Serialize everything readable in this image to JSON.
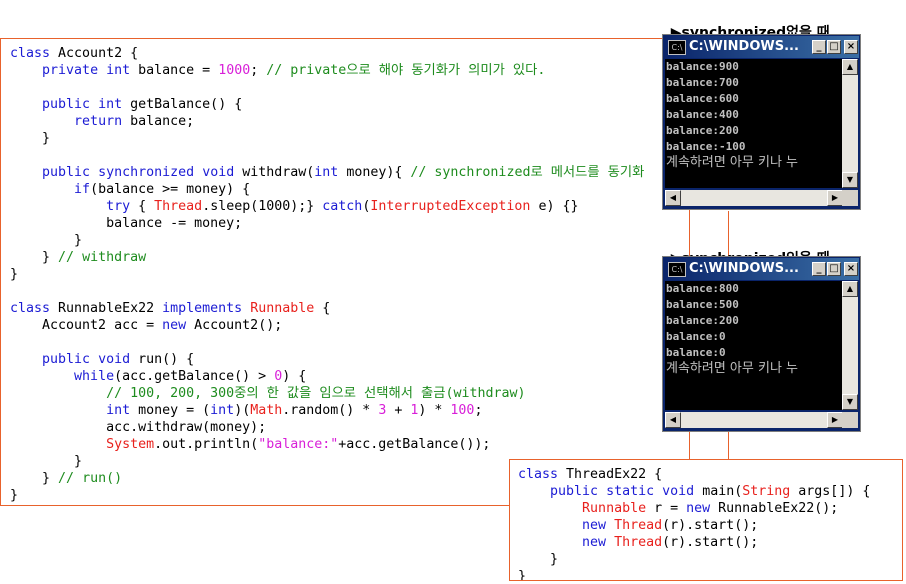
{
  "main_code": {
    "lines": [
      [
        [
          "kw",
          "class"
        ],
        [
          "txt",
          " Account2 {"
        ]
      ],
      [
        [
          "txt",
          "    "
        ],
        [
          "kw",
          "private"
        ],
        [
          "txt",
          " "
        ],
        [
          "kw",
          "int"
        ],
        [
          "txt",
          " balance = "
        ],
        [
          "num",
          "1000"
        ],
        [
          "txt",
          "; "
        ],
        [
          "cm",
          "// private으로 해야 동기화가 의미가 있다."
        ]
      ],
      [
        [
          "txt",
          ""
        ]
      ],
      [
        [
          "txt",
          "    "
        ],
        [
          "kw",
          "public"
        ],
        [
          "txt",
          " "
        ],
        [
          "kw",
          "int"
        ],
        [
          "txt",
          " getBalance() {"
        ]
      ],
      [
        [
          "txt",
          "        "
        ],
        [
          "kw",
          "return"
        ],
        [
          "txt",
          " balance;"
        ]
      ],
      [
        [
          "txt",
          "    }"
        ]
      ],
      [
        [
          "txt",
          ""
        ]
      ],
      [
        [
          "txt",
          "    "
        ],
        [
          "kw",
          "public"
        ],
        [
          "txt",
          " "
        ],
        [
          "kw",
          "synchronized"
        ],
        [
          "txt",
          " "
        ],
        [
          "kw",
          "void"
        ],
        [
          "txt",
          " withdraw("
        ],
        [
          "kw",
          "int"
        ],
        [
          "txt",
          " money){ "
        ],
        [
          "cm",
          "// synchronized로 메서드를 동기화"
        ]
      ],
      [
        [
          "txt",
          "        "
        ],
        [
          "kw",
          "if"
        ],
        [
          "txt",
          "(balance >= money) {"
        ]
      ],
      [
        [
          "txt",
          "            "
        ],
        [
          "kw",
          "try"
        ],
        [
          "txt",
          " { "
        ],
        [
          "cls",
          "Thread"
        ],
        [
          "txt",
          ".sleep(1000);} "
        ],
        [
          "kw",
          "catch"
        ],
        [
          "txt",
          "("
        ],
        [
          "cls",
          "InterruptedException"
        ],
        [
          "txt",
          " e) {}"
        ]
      ],
      [
        [
          "txt",
          "            balance -= money;"
        ]
      ],
      [
        [
          "txt",
          "        }"
        ]
      ],
      [
        [
          "txt",
          "    } "
        ],
        [
          "cm",
          "// withdraw"
        ]
      ],
      [
        [
          "txt",
          "}"
        ]
      ],
      [
        [
          "txt",
          ""
        ]
      ],
      [
        [
          "kw",
          "class"
        ],
        [
          "txt",
          " RunnableEx22 "
        ],
        [
          "kw",
          "implements"
        ],
        [
          "txt",
          " "
        ],
        [
          "cls",
          "Runnable"
        ],
        [
          "txt",
          " {"
        ]
      ],
      [
        [
          "txt",
          "    Account2 acc = "
        ],
        [
          "kw",
          "new"
        ],
        [
          "txt",
          " Account2();"
        ]
      ],
      [
        [
          "txt",
          ""
        ]
      ],
      [
        [
          "txt",
          "    "
        ],
        [
          "kw",
          "public"
        ],
        [
          "txt",
          " "
        ],
        [
          "kw",
          "void"
        ],
        [
          "txt",
          " run() {"
        ]
      ],
      [
        [
          "txt",
          "        "
        ],
        [
          "kw",
          "while"
        ],
        [
          "txt",
          "(acc.getBalance() > "
        ],
        [
          "num",
          "0"
        ],
        [
          "txt",
          ") {"
        ]
      ],
      [
        [
          "txt",
          "            "
        ],
        [
          "cm",
          "// 100, 200, 300중의 한 값을 임으로 선택해서 출금(withdraw)"
        ]
      ],
      [
        [
          "txt",
          "            "
        ],
        [
          "kw",
          "int"
        ],
        [
          "txt",
          " money = ("
        ],
        [
          "kw",
          "int"
        ],
        [
          "txt",
          ")("
        ],
        [
          "cls",
          "Math"
        ],
        [
          "txt",
          ".random() * "
        ],
        [
          "num",
          "3"
        ],
        [
          "txt",
          " + "
        ],
        [
          "num",
          "1"
        ],
        [
          "txt",
          ") * "
        ],
        [
          "num",
          "100"
        ],
        [
          "txt",
          ";"
        ]
      ],
      [
        [
          "txt",
          "            acc.withdraw(money);"
        ]
      ],
      [
        [
          "txt",
          "            "
        ],
        [
          "cls",
          "System"
        ],
        [
          "txt",
          ".out.println("
        ],
        [
          "str",
          "\"balance:\""
        ],
        [
          "txt",
          "+acc.getBalance());"
        ]
      ],
      [
        [
          "txt",
          "        }"
        ]
      ],
      [
        [
          "txt",
          "    } "
        ],
        [
          "cm",
          "// run()"
        ]
      ],
      [
        [
          "txt",
          "}"
        ]
      ]
    ]
  },
  "bottom_code": {
    "lines": [
      [
        [
          "kw",
          "class"
        ],
        [
          "txt",
          " ThreadEx22 {"
        ]
      ],
      [
        [
          "txt",
          "    "
        ],
        [
          "kw",
          "public"
        ],
        [
          "txt",
          " "
        ],
        [
          "kw",
          "static"
        ],
        [
          "txt",
          " "
        ],
        [
          "kw",
          "void"
        ],
        [
          "txt",
          " main("
        ],
        [
          "cls",
          "String"
        ],
        [
          "txt",
          " args[]) {"
        ]
      ],
      [
        [
          "txt",
          "        "
        ],
        [
          "cls",
          "Runnable"
        ],
        [
          "txt",
          " r = "
        ],
        [
          "kw",
          "new"
        ],
        [
          "txt",
          " RunnableEx22();"
        ]
      ],
      [
        [
          "txt",
          "        "
        ],
        [
          "kw",
          "new"
        ],
        [
          "txt",
          " "
        ],
        [
          "cls",
          "Thread"
        ],
        [
          "txt",
          "(r).start();"
        ]
      ],
      [
        [
          "txt",
          "        "
        ],
        [
          "kw",
          "new"
        ],
        [
          "txt",
          " "
        ],
        [
          "cls",
          "Thread"
        ],
        [
          "txt",
          "(r).start();"
        ]
      ],
      [
        [
          "txt",
          "    }"
        ]
      ],
      [
        [
          "txt",
          "}"
        ]
      ]
    ]
  },
  "caption_without": {
    "arrow": "▶",
    "text": "synchronized없을 때"
  },
  "caption_with": {
    "arrow": "▶",
    "text": "synchronized있을 때"
  },
  "console_without": {
    "title": "C:\\WINDOWS...",
    "lines": [
      "balance:900",
      "balance:700",
      "balance:600",
      "balance:400",
      "balance:200",
      "balance:-100"
    ],
    "prompt": "계속하려면 아무 키나 누"
  },
  "console_with": {
    "title": "C:\\WINDOWS...",
    "lines": [
      "balance:800",
      "balance:500",
      "balance:200",
      "balance:0",
      "balance:0"
    ],
    "prompt": "계속하려면 아무 키나 누"
  },
  "window_buttons": {
    "minimize": "_",
    "maximize": "□",
    "close": "×"
  },
  "icons": {
    "console_icon": "cmd-icon",
    "scroll_up": "▲",
    "scroll_down": "▼",
    "scroll_left": "◀",
    "scroll_right": "▶"
  },
  "colors": {
    "keyword": "#1c1cd4",
    "class": "#e8211d",
    "comment": "#1e8c1e",
    "string": "#d81fd8",
    "border": "#e8622c",
    "titlebar": "#0a246a"
  }
}
